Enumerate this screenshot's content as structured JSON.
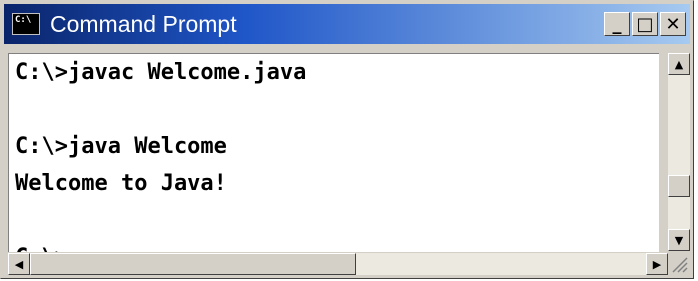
{
  "window": {
    "title": "Command Prompt",
    "icon": "console-icon",
    "icon_text": "C:\\",
    "buttons": {
      "minimize": "_",
      "maximize": "□",
      "close": "✕"
    }
  },
  "console": {
    "lines": [
      "C:\\>javac Welcome.java",
      "",
      "C:\\>java Welcome",
      "Welcome to Java!",
      "",
      "C:\\>"
    ]
  },
  "scrollbars": {
    "vertical_up": "▲",
    "vertical_down": "▼",
    "horizontal_left": "◀",
    "horizontal_right": "▶"
  },
  "colors": {
    "titlebar_start": "#0a246a",
    "titlebar_end": "#a6caf0",
    "console_bg": "#ffffff",
    "console_text": "#000000"
  }
}
